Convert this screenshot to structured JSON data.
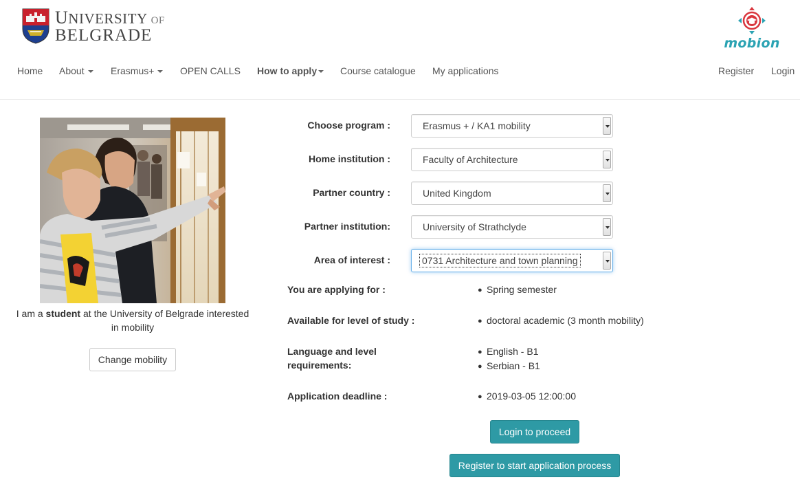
{
  "header": {
    "logo": {
      "line1_initial": "U",
      "line1_rest": "NIVERSITY",
      "line1_of": "OF",
      "line2": "BELGRADE"
    },
    "partner_logo": {
      "text": "mobion",
      "accent": "#2ba3b3",
      "icon": "graduation-cap-target-icon"
    }
  },
  "nav": {
    "home": "Home",
    "about": "About",
    "erasmus": "Erasmus+",
    "open_calls": "OPEN CALLS",
    "how_to_apply": "How to apply",
    "catalogue": "Course catalogue",
    "my_applications": "My applications",
    "register": "Register",
    "login": "Login"
  },
  "profile": {
    "caption_prefix": "I am a ",
    "caption_role": "student",
    "caption_suffix": " at the University of Belgrade interested in mobility",
    "change_button": "Change mobility"
  },
  "form": {
    "program": {
      "label": "Choose program :",
      "value": "Erasmus + / KA1 mobility"
    },
    "home_institution": {
      "label": "Home institution :",
      "value": "Faculty of Architecture"
    },
    "partner_country": {
      "label": "Partner country :",
      "value": "United Kingdom"
    },
    "partner_institution": {
      "label": "Partner institution:",
      "value": "University of Strathclyde"
    },
    "area": {
      "label": "Area of interest :",
      "value": "0731 Architecture and town planning"
    }
  },
  "info": {
    "applying_label": "You are applying for :",
    "applying_value": "Spring semester",
    "level_label": "Available for level of study :",
    "level_value": "doctoral academic (3 month mobility)",
    "lang_label_1": "Language and level",
    "lang_label_2": "requirements:",
    "lang_values": [
      "English - B1",
      "Serbian - B1"
    ],
    "deadline_label": "Application deadline :",
    "deadline_value": "2019-03-05 12:00:00"
  },
  "actions": {
    "login": "Login to proceed",
    "register": "Register to start application process",
    "accent": "#2e9aa5"
  }
}
